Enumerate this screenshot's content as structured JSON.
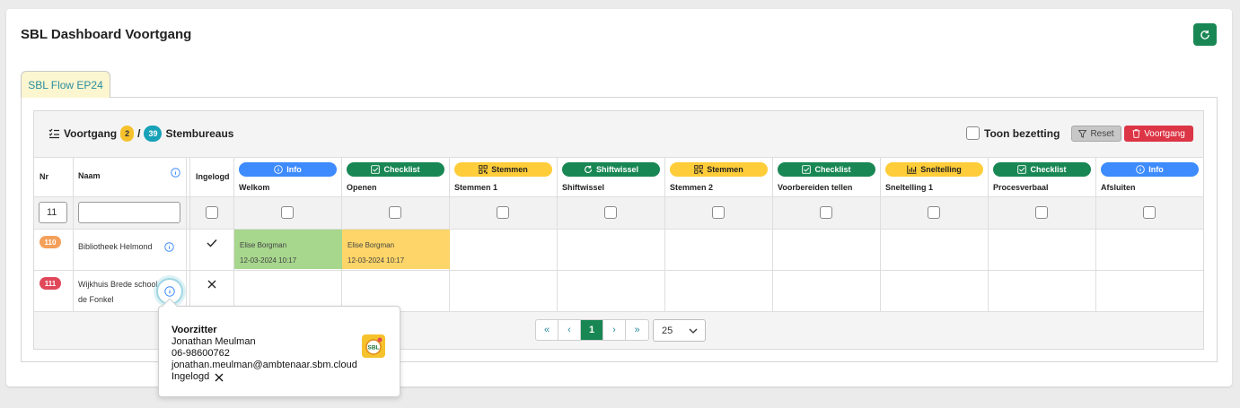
{
  "header": {
    "title": "SBL Dashboard Voortgang",
    "refresh_icon": "refresh-icon"
  },
  "tab": {
    "label": "SBL Flow EP24"
  },
  "toolbar": {
    "title": "Voortgang",
    "done_count": "2",
    "separator": "/",
    "total_count": "39",
    "unit_label": "Stembureaus",
    "toon_bezetting_label": "Toon bezetting",
    "toon_bezetting_checked": false,
    "reset_label": "Reset",
    "voortgang_label": "Voortgang"
  },
  "table": {
    "col_nr": "Nr",
    "col_naam": "Naam",
    "col_ingelogd": "Ingelogd",
    "steps": [
      {
        "badge": "Info",
        "badge_color": "#3d8bfd",
        "icon": "info-icon",
        "label": "Welkom"
      },
      {
        "badge": "Checklist",
        "badge_color": "#198754",
        "icon": "checklist-icon",
        "label": "Openen"
      },
      {
        "badge": "Stemmen",
        "badge_color": "#ffcd39",
        "icon": "qr-icon",
        "label": "Stemmen 1"
      },
      {
        "badge": "Shiftwissel",
        "badge_color": "#198754",
        "icon": "refresh-icon",
        "label": "Shiftwissel"
      },
      {
        "badge": "Stemmen",
        "badge_color": "#ffcd39",
        "icon": "qr-icon",
        "label": "Stemmen 2"
      },
      {
        "badge": "Checklist",
        "badge_color": "#198754",
        "icon": "checklist-icon",
        "label": "Voorbereiden tellen"
      },
      {
        "badge": "Sneltelling",
        "badge_color": "#ffcd39",
        "icon": "bar-chart-icon",
        "label": "Sneltelling 1"
      },
      {
        "badge": "Checklist",
        "badge_color": "#198754",
        "icon": "checklist-icon",
        "label": "Procesverbaal"
      },
      {
        "badge": "Info",
        "badge_color": "#3d8bfd",
        "icon": "info-icon",
        "label": "Afsluiten"
      }
    ],
    "filter_nr": "11",
    "filter_naam": "",
    "rows": [
      {
        "nr": "110",
        "nr_color": "#f5a05a",
        "naam": "Bibliotheek Helmond",
        "ingelogd": "check",
        "cells": [
          {
            "name": "Elise Borgman",
            "time": "12-03-2024 10:17",
            "color": "#a7d68d"
          },
          {
            "name": "Elise Borgman",
            "time": "12-03-2024 10:17",
            "color": "#fdd568"
          }
        ]
      },
      {
        "nr": "111",
        "nr_color": "#e0485a",
        "naam_line1": "Wijkhuis Brede school",
        "naam_line2": "de Fonkel",
        "ingelogd": "cross"
      }
    ]
  },
  "pagination": {
    "first": "«",
    "prev": "‹",
    "current": "1",
    "next": "›",
    "last": "»",
    "page_size": "25"
  },
  "popover": {
    "role": "Voorzitter",
    "name": "Jonathan Meulman",
    "phone": "06-98600762",
    "email": "jonathan.meulman@ambtenaar.sbm.cloud",
    "status_label": "Ingelogd",
    "logo_text": "SBL"
  }
}
